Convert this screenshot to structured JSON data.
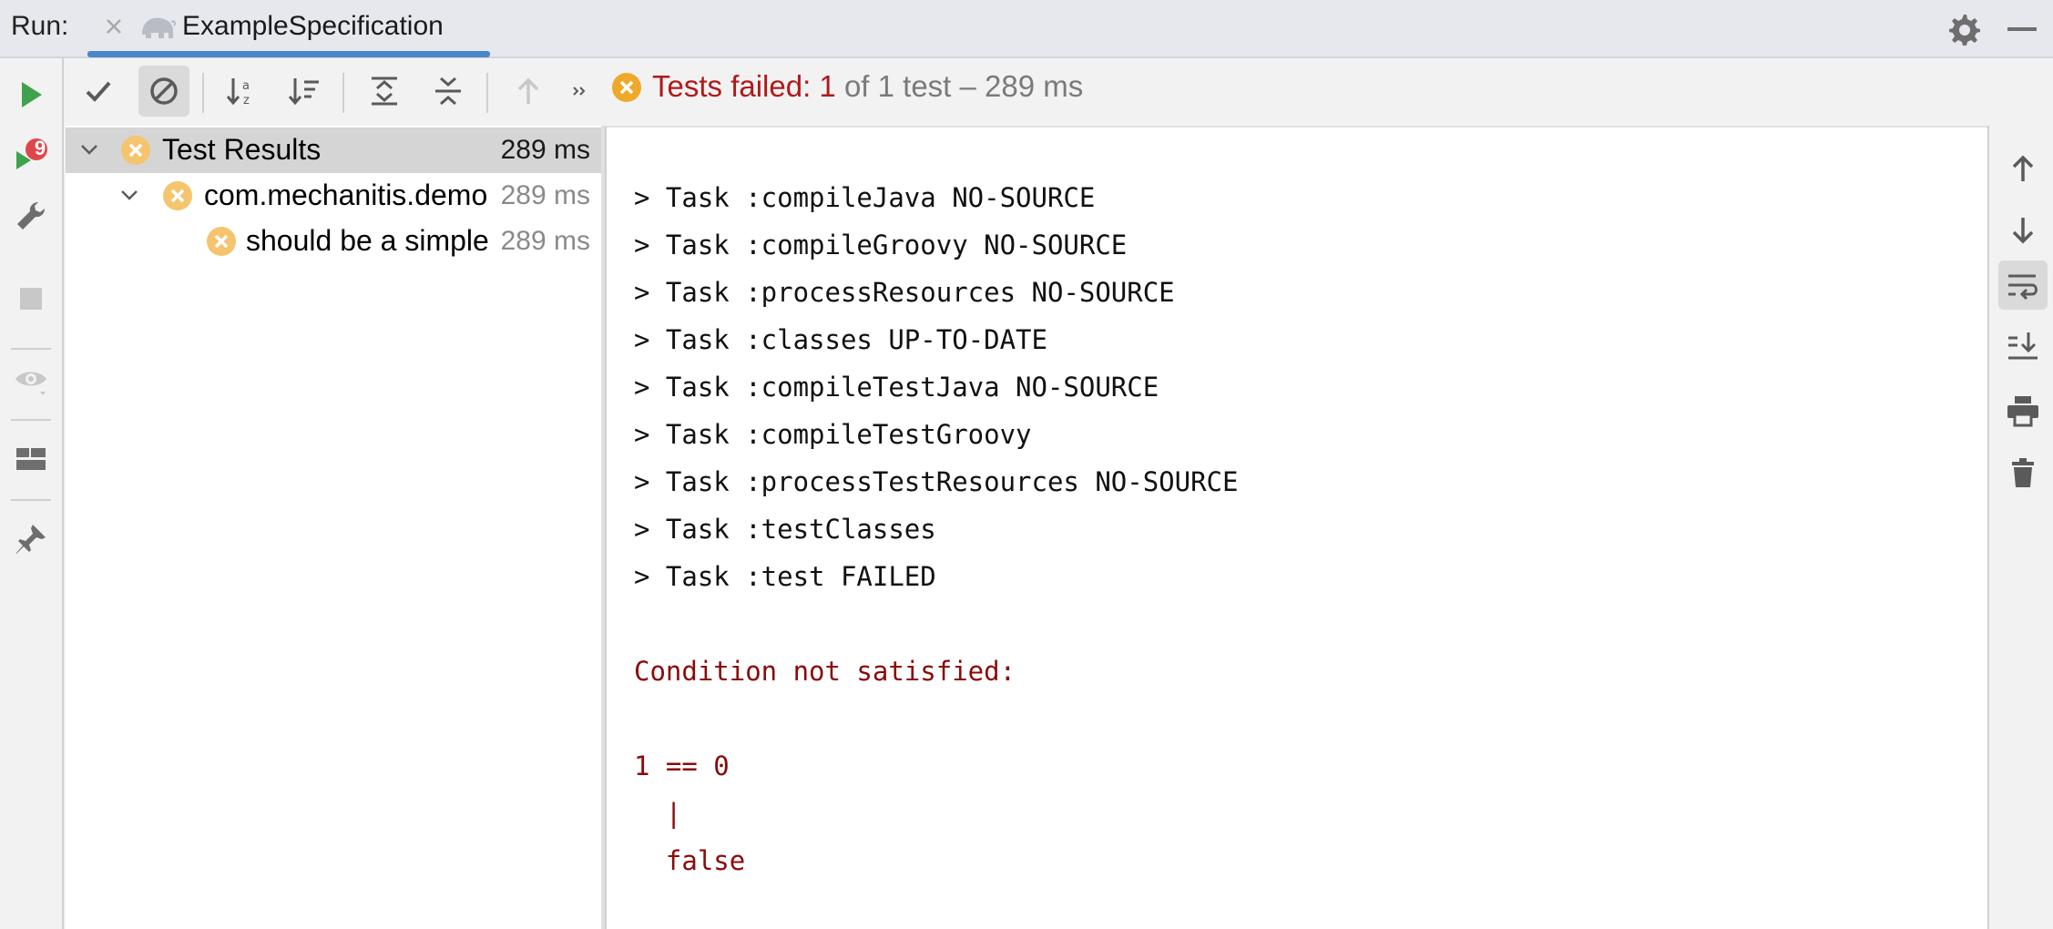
{
  "titlebar": {
    "run_label": "Run:",
    "tab_title": "ExampleSpecification"
  },
  "status": {
    "prefix": "Tests failed: ",
    "failed": "1",
    "suffix": " of 1 test – 289 ms"
  },
  "leftbar": {
    "badge_count": "9"
  },
  "tree": {
    "rows": [
      {
        "label": "Test Results",
        "time": "289 ms"
      },
      {
        "label": "com.mechanitis.demo.ExampleSpecification",
        "time": "289 ms"
      },
      {
        "label": "should be a simple assertion",
        "time": "289 ms"
      }
    ]
  },
  "console": {
    "lines": [
      "> Task :compileJava NO-SOURCE",
      "> Task :compileGroovy NO-SOURCE",
      "> Task :processResources NO-SOURCE",
      "> Task :classes UP-TO-DATE",
      "> Task :compileTestJava NO-SOURCE",
      "> Task :compileTestGroovy",
      "> Task :processTestResources NO-SOURCE",
      "> Task :testClasses",
      "> Task :test FAILED"
    ],
    "error_lines": [
      "Condition not satisfied:",
      "1 == 0",
      "  |",
      "  false"
    ]
  },
  "colors": {
    "accent": "#4a86c8",
    "error_text": "#b01a1a",
    "fail_icon": "#f0b24a",
    "run_green": "#3fa34d"
  }
}
